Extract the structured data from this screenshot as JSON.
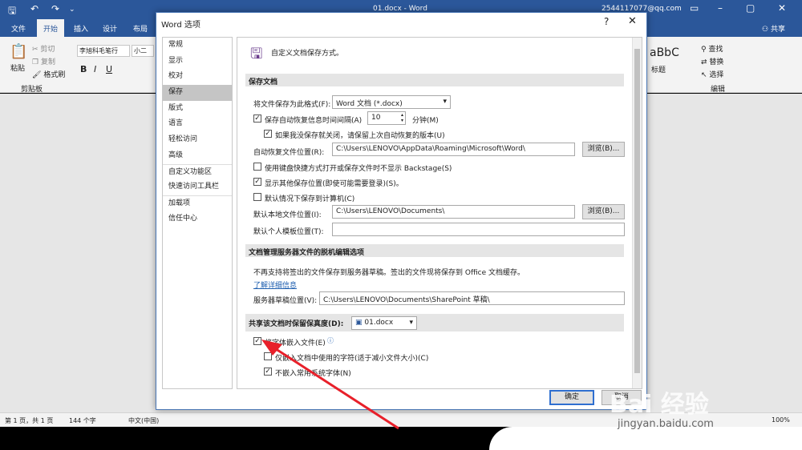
{
  "titlebar": {
    "document_title": "01.docx  -  Word",
    "account": "2544117077@qq.com",
    "share": "共享"
  },
  "ribbon_tabs": [
    "文件",
    "开始",
    "插入",
    "设计",
    "布局"
  ],
  "ribbon": {
    "paste": "粘贴",
    "cut": "剪切",
    "copy": "复制",
    "format_painter": "格式刷",
    "clipboard_group": "剪贴板",
    "font_name": "李旭科毛笔行",
    "font_size": "小二",
    "style_preview": "aBbC",
    "style_label": "标题",
    "find": "查找",
    "replace": "替换",
    "select": "选择",
    "editing_group": "编辑"
  },
  "dialog": {
    "title": "Word 选项",
    "help": "?",
    "close": "✕",
    "nav": [
      "常规",
      "显示",
      "校对",
      "保存",
      "版式",
      "语言",
      "轻松访问",
      "高级",
      "自定义功能区",
      "快速访问工具栏",
      "加载项",
      "信任中心"
    ],
    "header": "自定义文档保存方式。",
    "save_section": "保存文档",
    "save_format_label": "将文件保存为此格式(F):",
    "save_format_value": "Word 文档 (*.docx)",
    "autorecover_label": "保存自动恢复信息时间间隔(A)",
    "autorecover_minutes": "10",
    "minutes_label": "分钟(M)",
    "keep_last_label": "如果我没保存就关闭，请保留上次自动恢复的版本(U)",
    "autorecover_location_label": "自动恢复文件位置(R):",
    "autorecover_location_value": "C:\\Users\\LENOVO\\AppData\\Roaming\\Microsoft\\Word\\",
    "browse1": "浏览(B)...",
    "backstage_label": "使用键盘快捷方式打开或保存文件时不显示 Backstage(S)",
    "show_places_label": "显示其他保存位置(即使可能需要登录)(S)。",
    "save_to_computer_label": "默认情况下保存到计算机(C)",
    "local_location_label": "默认本地文件位置(I):",
    "local_location_value": "C:\\Users\\LENOVO\\Documents\\",
    "browse2": "浏览(B)...",
    "template_location_label": "默认个人模板位置(T):",
    "template_location_value": "",
    "offline_section": "文档管理服务器文件的脱机编辑选项",
    "offline_text": "不再支持将签出的文件保存到服务器草稿。签出的文件现将保存到 Office 文档缓存。",
    "learn_more": "了解详细信息",
    "drafts_label": "服务器草稿位置(V):",
    "drafts_value": "C:\\Users\\LENOVO\\Documents\\SharePoint 草稿\\",
    "fidelity_section": "共享该文档时保留保真度(D):",
    "fidelity_doc": "01.docx",
    "embed_fonts_label": "将字体嵌入文件(E)",
    "embed_used_label": "仅嵌入文档中使用的字符(适于减小文件大小)(C)",
    "no_common_label": "不嵌入常用系统字体(N)",
    "ok": "确定",
    "cancel": "取消"
  },
  "statusbar": {
    "page": "第 1 页，共 1 页",
    "words": "144 个字",
    "language": "中文(中国)",
    "zoom": "100%"
  },
  "watermark": {
    "brand": "Bai 经验",
    "url": "jingyan.baidu.com"
  }
}
